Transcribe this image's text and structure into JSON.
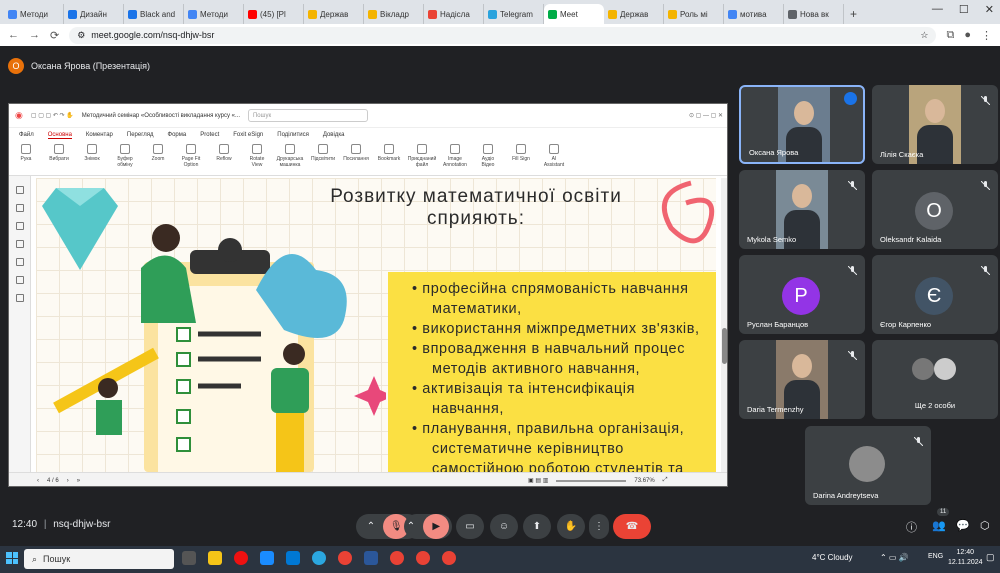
{
  "browser": {
    "tabs": [
      {
        "label": "Методи",
        "color": "#4285f4"
      },
      {
        "label": "Дизайн",
        "color": "#1a73e8"
      },
      {
        "label": "Black and",
        "color": "#1a73e8"
      },
      {
        "label": "Методи",
        "color": "#4285f4"
      },
      {
        "label": "(45) [Pl",
        "color": "#ff0000"
      },
      {
        "label": "Держав",
        "color": "#f4b400"
      },
      {
        "label": "Вікладр",
        "color": "#f4b400"
      },
      {
        "label": "Надісла",
        "color": "#ea4335"
      },
      {
        "label": "Telegram",
        "color": "#2aa3dd"
      },
      {
        "label": "Meet",
        "color": "#00ac47",
        "active": true
      },
      {
        "label": "Держав",
        "color": "#f4b400"
      },
      {
        "label": "Роль мі",
        "color": "#f4b400"
      },
      {
        "label": "мотива",
        "color": "#4285f4"
      },
      {
        "label": "Нова вк",
        "color": "#5f6368"
      }
    ],
    "url": "meet.google.com/nsq-dhjw-bsr"
  },
  "meet": {
    "presenter_initial": "О",
    "presenter_label": "Оксана Ярова (Презентація)",
    "time": "12:40",
    "meeting_code": "nsq-dhjw-bsr",
    "participants_count": "11"
  },
  "pdf": {
    "doc_title": "Методичний семінар «Особливості викладання курсу «...",
    "search_placeholder": "Пошук",
    "menu": [
      "Файл",
      "Основна",
      "Коментар",
      "Перегляд",
      "Форма",
      "Protect",
      "Foxit eSign",
      "Поділитися",
      "Довідка"
    ],
    "ribbon": [
      "Рука",
      "Вибрати",
      "Знімок",
      "Буфер обміну",
      "Zoom",
      "Page Fit Option",
      "Reflow",
      "Rotate View",
      "Друкарська машинка",
      "Підсвітити",
      "Посилання",
      "Bookmark",
      "Приєднаний файл",
      "Image Annotation",
      "Аудіо Відео",
      "Fill Sign",
      "AI Assistant"
    ],
    "page": "4 / 6",
    "zoom": "73.67%"
  },
  "slide": {
    "title_line1": "Розвитку математичної освіти",
    "title_line2": "сприяють:",
    "lines": [
      "•  професійна спрямованість навчання",
      "математики,",
      "•  використання міжпредметних зв'язків,",
      "•  впровадження в навчальний процес",
      "методів активного навчання,",
      "•  активізація та інтенсифікація",
      "навчання,",
      "•  планування, правильна організація,",
      "систематичне керівництво",
      "самостійною роботою студентів та"
    ]
  },
  "participants": [
    {
      "name": "Оксана Ярова",
      "type": "video"
    },
    {
      "name": "Лілія Скаєка",
      "type": "video"
    },
    {
      "name": "Mykola Semko",
      "type": "video"
    },
    {
      "name": "Oleksandr Kalaida",
      "initial": "O",
      "color": "#5f6368"
    },
    {
      "name": "Руслан Баранцов",
      "initial": "P",
      "color": "#9334e6"
    },
    {
      "name": "Єгор Карпенко",
      "initial": "Є",
      "color": "#425466"
    },
    {
      "name": "Daria Termenzhy",
      "type": "video"
    },
    {
      "name": "Ще 2 особи"
    },
    {
      "name": "Darina Andreytseva"
    }
  ],
  "taskbar": {
    "search": "Пошук",
    "weather": "4°C  Cloudy",
    "lang": "ENG",
    "time": "12:40",
    "date": "12.11.2024"
  }
}
